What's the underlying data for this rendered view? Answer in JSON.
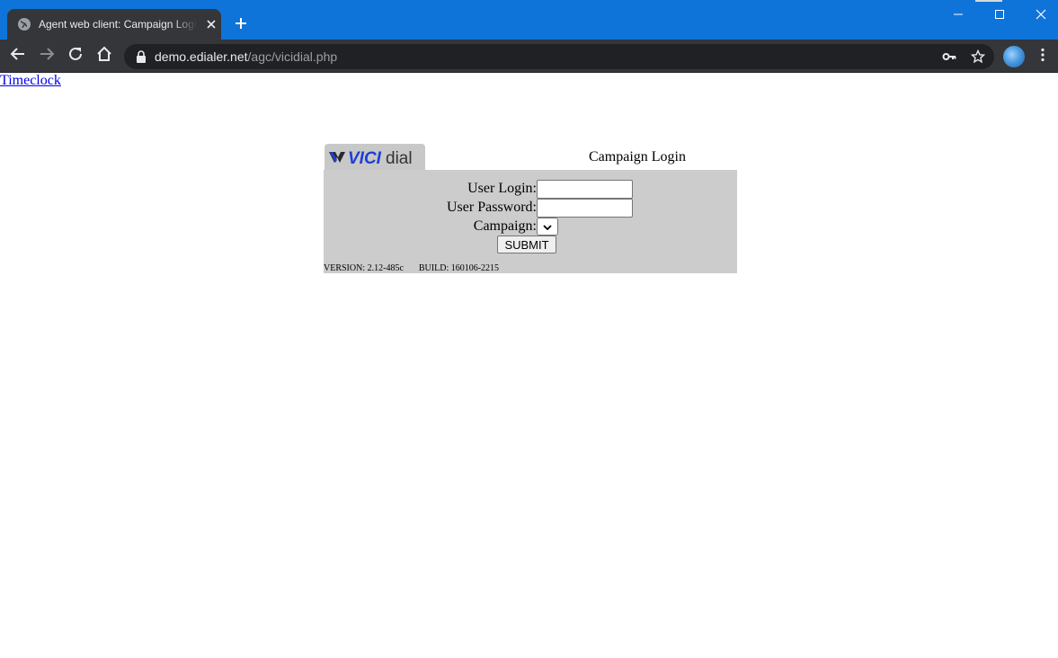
{
  "browser": {
    "tab_title": "Agent web client: Campaign Login",
    "url_host": "demo.edialer.net",
    "url_path": "/agc/vicidial.php",
    "icons": [
      "globe-icon",
      "close-icon",
      "plus-icon",
      "back-arrow-icon",
      "forward-arrow-icon",
      "reload-icon",
      "home-icon",
      "lock-icon",
      "key-icon",
      "star-icon",
      "kebab-menu-icon"
    ],
    "colors": {
      "titlebar": "#0f74d9",
      "toolbar": "#35363a",
      "omnibox": "#202124"
    }
  },
  "page": {
    "timeclock_link": "Timeclock",
    "logo": {
      "part1": "VICI",
      "part2": "dial"
    },
    "login": {
      "title": "Campaign Login",
      "user_login_label": "User Login:",
      "user_login_value": "",
      "user_password_label": "User Password:",
      "user_password_value": "",
      "campaign_label": "Campaign:",
      "campaign_selected": "",
      "submit_label": "SUBMIT",
      "version": "VERSION: 2.12-485c",
      "build": "BUILD: 160106-2215"
    },
    "colors": {
      "panel": "#cccccc",
      "link": "#0000ee",
      "logo_blue": "#1d3fd6"
    }
  }
}
